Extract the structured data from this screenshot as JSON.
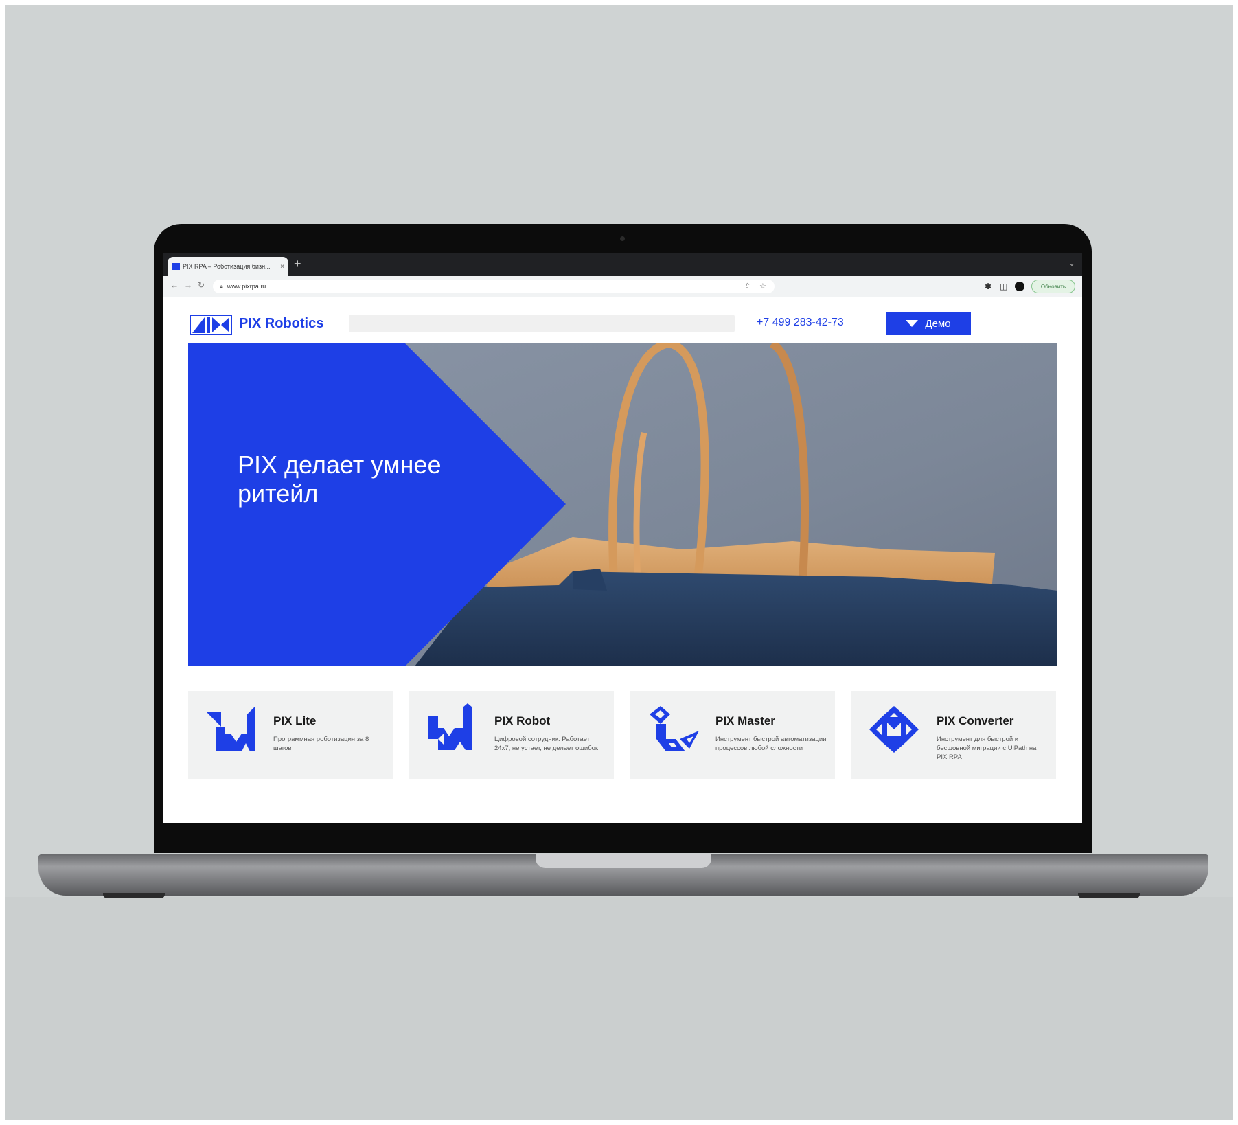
{
  "browser": {
    "tab_title": "PIX RPA – Роботизация бизн...",
    "tab_close": "×",
    "new_tab": "+",
    "url": "www.pixrpa.ru",
    "update_label": "Обновить"
  },
  "header": {
    "logo_text": "PIX Robotics",
    "phone": "+7 499 283-42-73",
    "demo_label": "Демо"
  },
  "hero": {
    "title": "PIX делает умнее\nритейл"
  },
  "products": [
    {
      "title": "PIX Lite",
      "desc": "Программная роботизация за 8 шагов"
    },
    {
      "title": "PIX Robot",
      "desc": "Цифровой сотрудник. Работает 24x7, не устает, не делает ошибок"
    },
    {
      "title": "PIX Master",
      "desc": "Инструмент быстрой автоматизации процессов любой сложности"
    },
    {
      "title": "PIX Converter",
      "desc": "Инструмент для быстрой и бесшовной миграции с UiPath на PIX RPA"
    }
  ],
  "colors": {
    "brand_blue": "#1e3fe6",
    "backdrop": "#cfd3d3",
    "card_bg": "#f1f2f2"
  }
}
